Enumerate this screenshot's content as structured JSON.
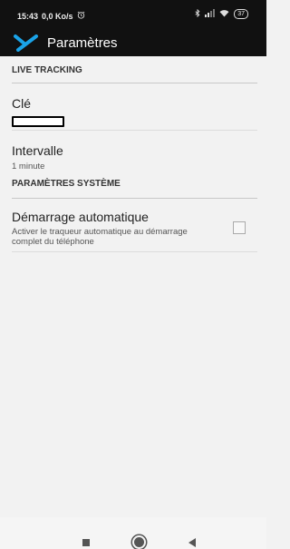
{
  "status_bar": {
    "time": "15:43",
    "speed": "0,0 Ko/s",
    "battery": "37"
  },
  "app_bar": {
    "title": "Paramètres",
    "logo_icon": "app-logo-icon"
  },
  "sections": {
    "live_tracking": {
      "header": "LIVE TRACKING",
      "key": {
        "title": "Clé",
        "value": ""
      },
      "interval": {
        "title": "Intervalle",
        "summary": "1 minute"
      }
    },
    "system": {
      "header": "PARAMÈTRES SYSTÈME",
      "autostart": {
        "title": "Démarrage automatique",
        "summary": "Activer le traqueur automatique au démarrage complet du téléphone",
        "checked": false
      }
    }
  },
  "colors": {
    "status_bar_bg": "#111111",
    "content_bg": "#f2f2f2",
    "logo_blue": "#1aa3e8"
  },
  "nav_bar": {
    "icons": [
      "recents-square-icon",
      "home-circle-icon",
      "back-triangle-icon"
    ]
  }
}
